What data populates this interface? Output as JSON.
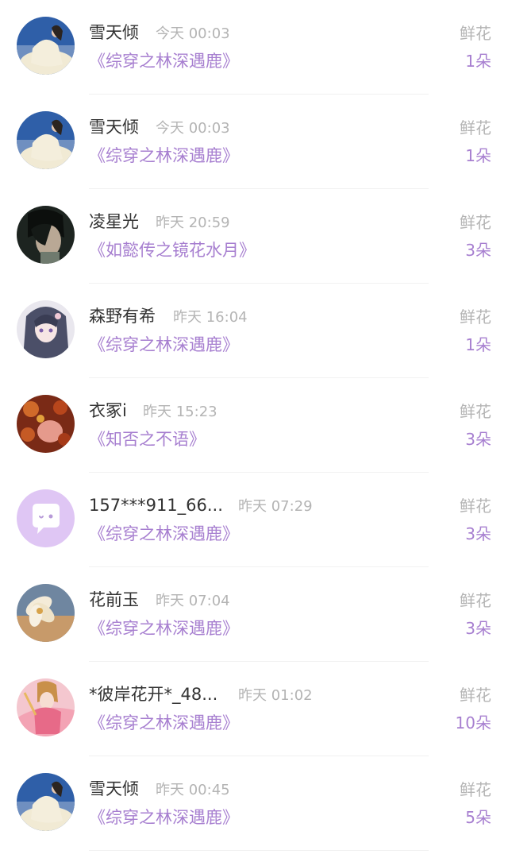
{
  "records": [
    {
      "user": "雪天倾",
      "time": "今天 00:03",
      "book": "《综穿之林深遇鹿》",
      "gift": "鲜花",
      "count": "1朵",
      "avatar": "woman-in-white-dress-avatar"
    },
    {
      "user": "雪天倾",
      "time": "今天 00:03",
      "book": "《综穿之林深遇鹿》",
      "gift": "鲜花",
      "count": "1朵",
      "avatar": "woman-in-white-dress-avatar"
    },
    {
      "user": "凌星光",
      "time": "昨天 20:59",
      "book": "《如懿传之镜花水月》",
      "gift": "鲜花",
      "count": "3朵",
      "avatar": "dark-haired-man-avatar"
    },
    {
      "user": "森野有希",
      "time": "昨天 16:04",
      "book": "《综穿之林深遇鹿》",
      "gift": "鲜花",
      "count": "1朵",
      "avatar": "anime-girl-avatar"
    },
    {
      "user": "衣冢i",
      "time": "昨天 15:23",
      "book": "《知否之不语》",
      "gift": "鲜花",
      "count": "3朵",
      "avatar": "red-flowers-face-avatar"
    },
    {
      "user": "157***911_66...",
      "time": "昨天 07:29",
      "book": "《综穿之林深遇鹿》",
      "gift": "鲜花",
      "count": "3朵",
      "avatar": "default-chat-bubble-avatar"
    },
    {
      "user": "花前玉",
      "time": "昨天 07:04",
      "book": "《综穿之林深遇鹿》",
      "gift": "鲜花",
      "count": "3朵",
      "avatar": "white-flower-avatar"
    },
    {
      "user": "*彼岸花开*_48...",
      "time": "昨天 01:02",
      "book": "《综穿之林深遇鹿》",
      "gift": "鲜花",
      "count": "10朵",
      "avatar": "costume-woman-avatar"
    },
    {
      "user": "雪天倾",
      "time": "昨天 00:45",
      "book": "《综穿之林深遇鹿》",
      "gift": "鲜花",
      "count": "5朵",
      "avatar": "woman-in-white-dress-avatar"
    }
  ],
  "colors": {
    "accent": "#a77fd0",
    "muted": "#b4b4b4",
    "name": "#333333"
  }
}
